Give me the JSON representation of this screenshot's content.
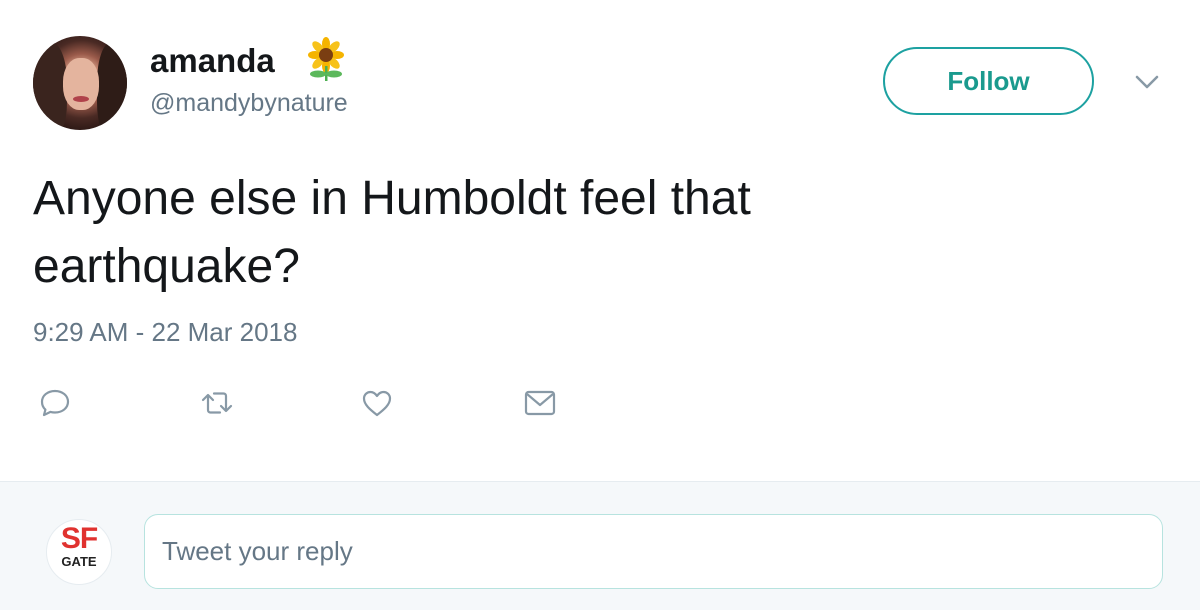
{
  "user": {
    "display_name": "amanda",
    "name_emoji": "sunflower-icon",
    "handle": "@mandybynature"
  },
  "header": {
    "follow_label": "Follow",
    "menu_icon": "chevron-down-icon"
  },
  "tweet": {
    "text_line1": "Anyone else in Humboldt feel that",
    "text_line2": "earthquake?",
    "timestamp": "9:29 AM - 22 Mar 2018"
  },
  "actions": [
    {
      "icon": "reply-icon"
    },
    {
      "icon": "retweet-icon"
    },
    {
      "icon": "like-icon"
    },
    {
      "icon": "direct-message-icon"
    }
  ],
  "reply": {
    "avatar_text_top": "SF",
    "avatar_text_bottom": "GATE",
    "placeholder": "Tweet your reply"
  },
  "colors": {
    "accent": "#1da1a1",
    "muted_text": "#657786",
    "reply_background": "#f5f8fa",
    "sfgate_red": "#e0322f"
  }
}
